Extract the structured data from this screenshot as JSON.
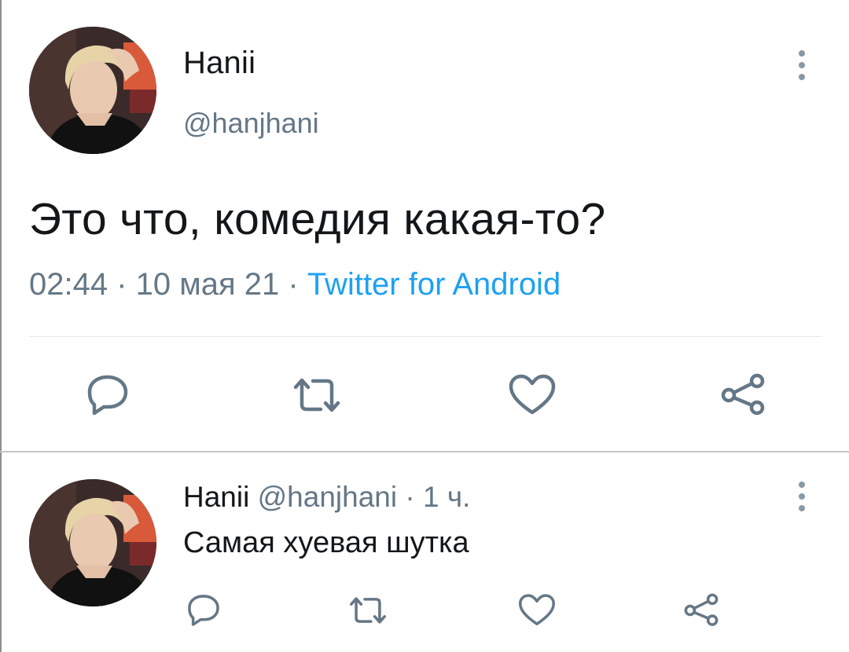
{
  "colors": {
    "text_primary": "#14171a",
    "text_secondary": "#657786",
    "link": "#1da1f2",
    "icon": "#657786",
    "divider": "#e1e8ed"
  },
  "main_tweet": {
    "avatar_icon": "user-avatar-photo",
    "display_name": "Hanii",
    "handle": "@hanjhani",
    "text": "Это что, комедия какая-то?",
    "time": "02:44",
    "sep1": " · ",
    "date": "10 мая 21",
    "sep2": " · ",
    "source": "Twitter for Android",
    "actions": [
      "reply-icon",
      "retweet-icon",
      "like-icon",
      "share-icon"
    ]
  },
  "reply_tweet": {
    "avatar_icon": "user-avatar-photo",
    "display_name": "Hanii",
    "handle": "@hanjhani",
    "separator": " · ",
    "time_ago": "1 ч.",
    "text": "Самая хуевая шутка",
    "actions": [
      "reply-icon",
      "retweet-icon",
      "like-icon",
      "share-icon"
    ]
  }
}
